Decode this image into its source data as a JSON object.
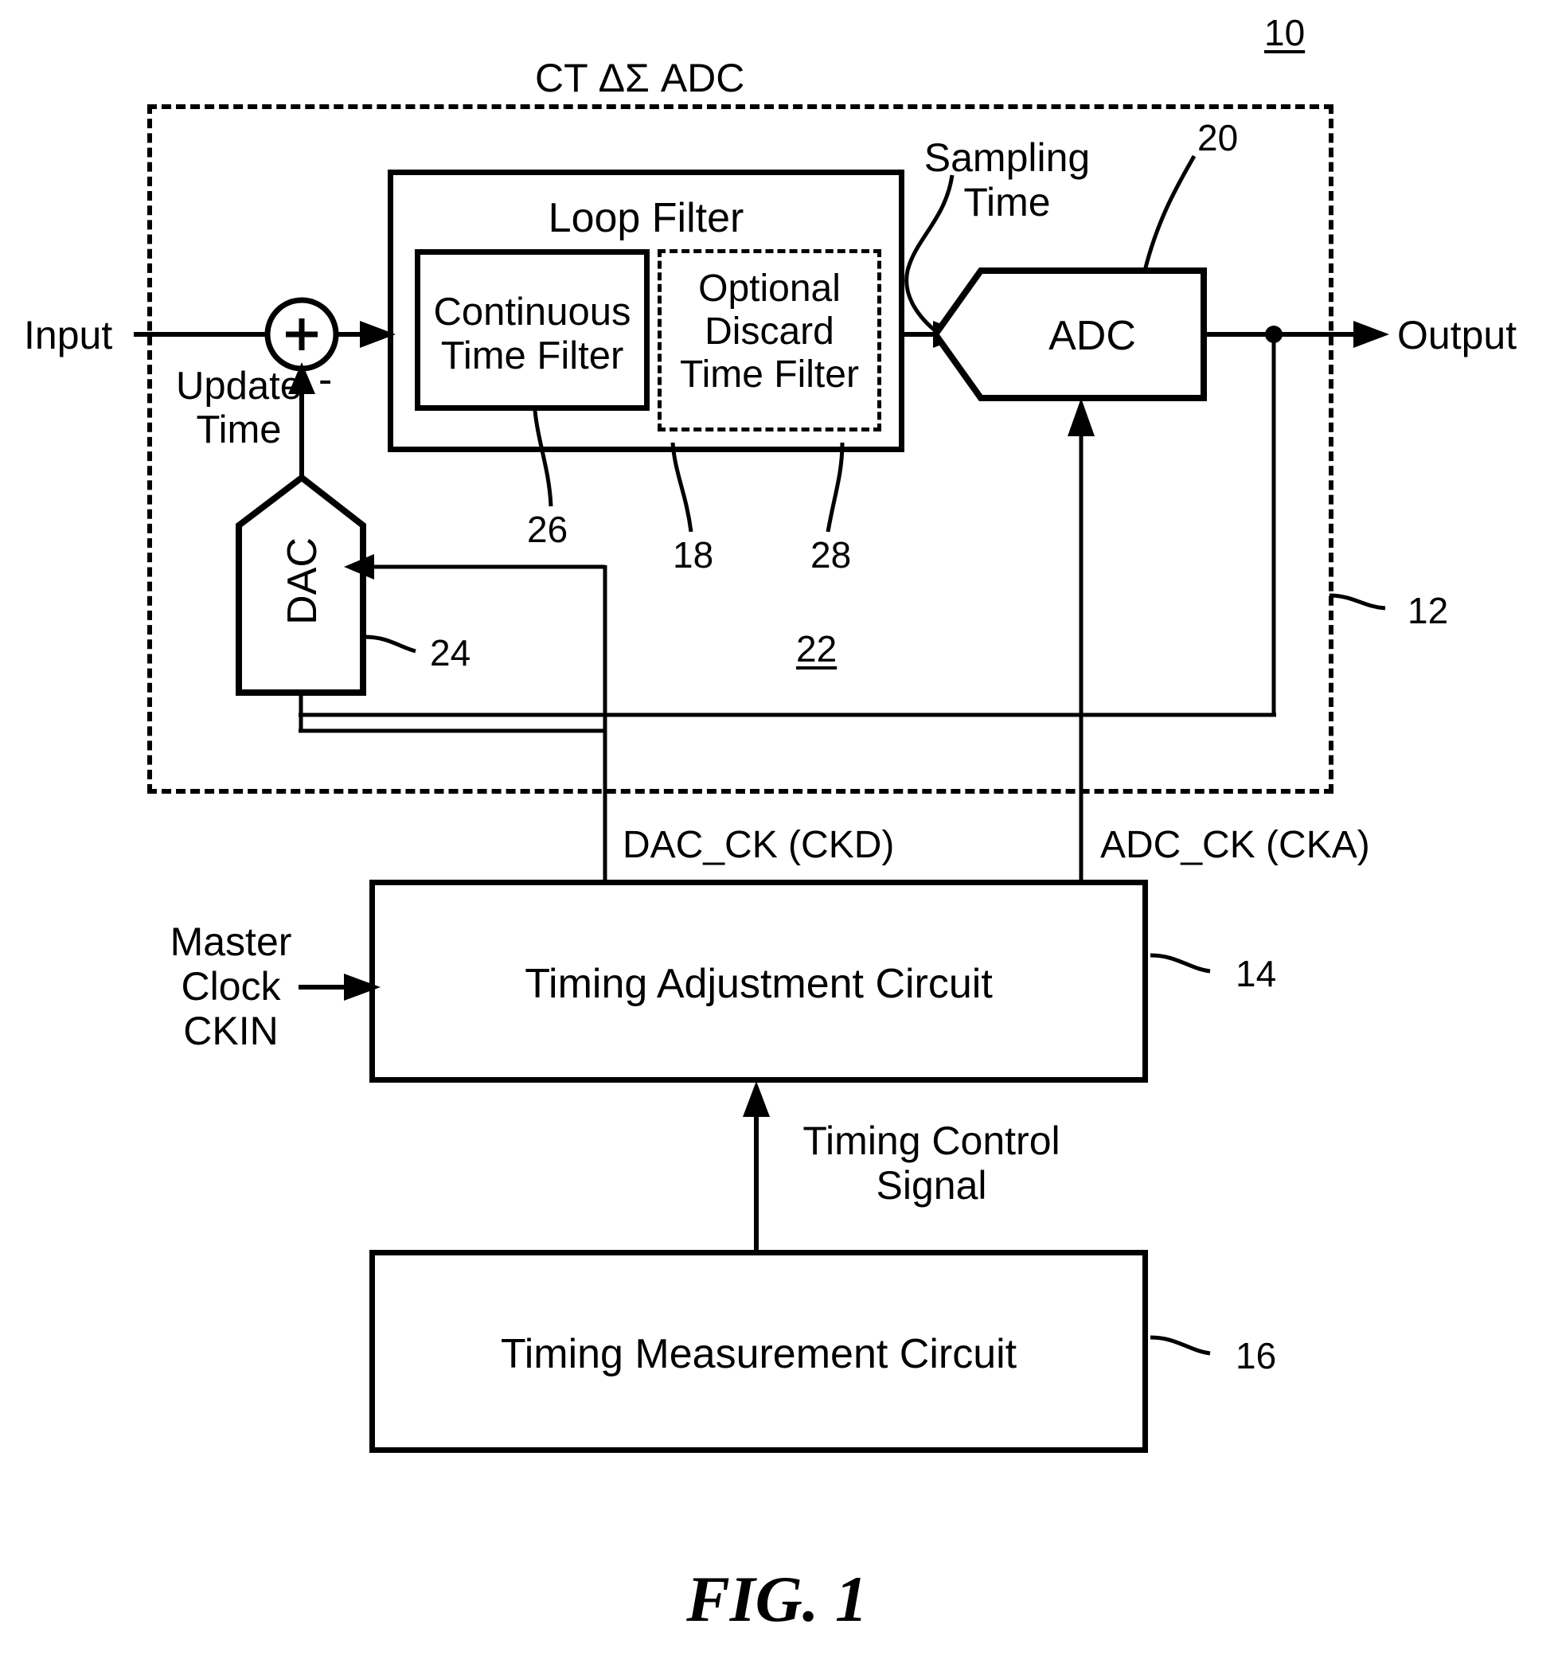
{
  "figure": {
    "caption": "FIG. 1",
    "top_reference": "10"
  },
  "system_block": {
    "title": "CT ΔΣ ADC",
    "reference": "12"
  },
  "signals": {
    "input_label": "Input",
    "output_label": "Output",
    "update_time_label": "Update\nTime",
    "sampling_time_label": "Sampling\nTime",
    "summer_plus": "+",
    "summer_minus": "-",
    "dac_clock_label": "DAC_CK (CKD)",
    "adc_clock_label": "ADC_CK (CKA)",
    "master_clock_label": "Master\nClock\nCKIN",
    "timing_control_label": "Timing Control\nSignal"
  },
  "blocks": {
    "loop_filter": {
      "title": "Loop Filter",
      "reference": "22",
      "continuous_time_filter": {
        "label": "Continuous\nTime Filter",
        "reference": "26"
      },
      "optional_discard_filter": {
        "label": "Optional\nDiscard\nTime Filter",
        "reference_left": "18",
        "reference_right": "28"
      }
    },
    "adc": {
      "label": "ADC",
      "reference": "20"
    },
    "dac": {
      "label": "DAC",
      "reference": "24"
    },
    "timing_adjustment": {
      "label": "Timing Adjustment Circuit",
      "reference": "14"
    },
    "timing_measurement": {
      "label": "Timing Measurement Circuit",
      "reference": "16"
    }
  },
  "colors": {
    "line": "#000000",
    "background": "#ffffff"
  }
}
